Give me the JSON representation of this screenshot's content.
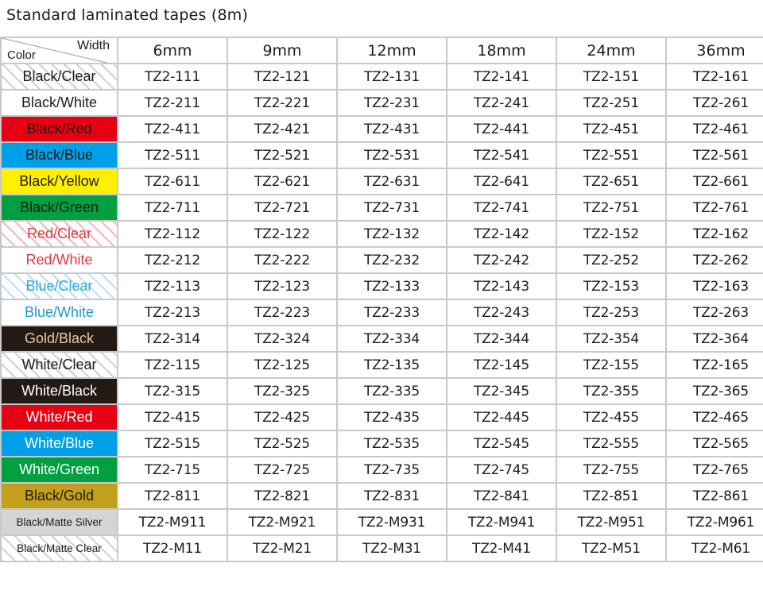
{
  "title": "Standard laminated tapes (8m)",
  "header": {
    "corner_row_label": "Color",
    "corner_col_label": "Width",
    "widths": [
      "6mm",
      "9mm",
      "12mm",
      "18mm",
      "24mm",
      "36mm"
    ]
  },
  "colors": {
    "header_bg": "#e2e2e2",
    "grid": "#c9c9c9",
    "red": "#e60012",
    "blue": "#00a0e9",
    "yellow": "#fff000",
    "green": "#00a040",
    "black": "#231a15",
    "gold_bg": "#c2a01b",
    "gold_text": "#e8c9a0",
    "silver": "#d4d4d4",
    "text_dark": "#1c1c1c",
    "white": "#ffffff"
  },
  "rows": [
    {
      "label": "Black/Clear",
      "bg": "#ffffff",
      "fg": "#1c1c1c",
      "hatch": "#c9c9c9",
      "small": false,
      "parts": [
        "TZ2-111",
        "TZ2-121",
        "TZ2-131",
        "TZ2-141",
        "TZ2-151",
        "TZ2-161"
      ]
    },
    {
      "label": "Black/White",
      "bg": "#ffffff",
      "fg": "#1c1c1c",
      "hatch": null,
      "small": false,
      "parts": [
        "TZ2-211",
        "TZ2-221",
        "TZ2-231",
        "TZ2-241",
        "TZ2-251",
        "TZ2-261"
      ]
    },
    {
      "label": "Black/Red",
      "bg": "#e60012",
      "fg": "#231a15",
      "hatch": null,
      "small": false,
      "parts": [
        "TZ2-411",
        "TZ2-421",
        "TZ2-431",
        "TZ2-441",
        "TZ2-451",
        "TZ2-461"
      ]
    },
    {
      "label": "Black/Blue",
      "bg": "#00a0e9",
      "fg": "#231a15",
      "hatch": null,
      "small": false,
      "parts": [
        "TZ2-511",
        "TZ2-521",
        "TZ2-531",
        "TZ2-541",
        "TZ2-551",
        "TZ2-561"
      ]
    },
    {
      "label": "Black/Yellow",
      "bg": "#fff000",
      "fg": "#231a15",
      "hatch": null,
      "small": false,
      "parts": [
        "TZ2-611",
        "TZ2-621",
        "TZ2-631",
        "TZ2-641",
        "TZ2-651",
        "TZ2-661"
      ]
    },
    {
      "label": "Black/Green",
      "bg": "#00a040",
      "fg": "#231a15",
      "hatch": null,
      "small": false,
      "parts": [
        "TZ2-711",
        "TZ2-721",
        "TZ2-731",
        "TZ2-741",
        "TZ2-751",
        "TZ2-761"
      ]
    },
    {
      "label": "Red/Clear",
      "bg": "#ffffff",
      "fg": "#e2373f",
      "hatch": "#f0a9ae",
      "small": false,
      "parts": [
        "TZ2-112",
        "TZ2-122",
        "TZ2-132",
        "TZ2-142",
        "TZ2-152",
        "TZ2-162"
      ]
    },
    {
      "label": "Red/White",
      "bg": "#ffffff",
      "fg": "#e2373f",
      "hatch": null,
      "small": false,
      "parts": [
        "TZ2-212",
        "TZ2-222",
        "TZ2-232",
        "TZ2-242",
        "TZ2-252",
        "TZ2-262"
      ]
    },
    {
      "label": "Blue/Clear",
      "bg": "#ffffff",
      "fg": "#2aa7e0",
      "hatch": "#abdcf3",
      "small": false,
      "parts": [
        "TZ2-113",
        "TZ2-123",
        "TZ2-133",
        "TZ2-143",
        "TZ2-153",
        "TZ2-163"
      ]
    },
    {
      "label": "Blue/White",
      "bg": "#ffffff",
      "fg": "#1b9ada",
      "hatch": null,
      "small": false,
      "parts": [
        "TZ2-213",
        "TZ2-223",
        "TZ2-233",
        "TZ2-243",
        "TZ2-253",
        "TZ2-263"
      ]
    },
    {
      "label": "Gold/Black",
      "bg": "#231a15",
      "fg": "#e8c9a0",
      "hatch": null,
      "small": false,
      "parts": [
        "TZ2-314",
        "TZ2-324",
        "TZ2-334",
        "TZ2-344",
        "TZ2-354",
        "TZ2-364"
      ]
    },
    {
      "label": "White/Clear",
      "bg": "#ffffff",
      "fg": "#1c1c1c",
      "hatch": "#c9c9c9",
      "small": false,
      "parts": [
        "TZ2-115",
        "TZ2-125",
        "TZ2-135",
        "TZ2-145",
        "TZ2-155",
        "TZ2-165"
      ]
    },
    {
      "label": "White/Black",
      "bg": "#231a15",
      "fg": "#ffffff",
      "hatch": null,
      "small": false,
      "parts": [
        "TZ2-315",
        "TZ2-325",
        "TZ2-335",
        "TZ2-345",
        "TZ2-355",
        "TZ2-365"
      ]
    },
    {
      "label": "White/Red",
      "bg": "#e60012",
      "fg": "#ffffff",
      "hatch": null,
      "small": false,
      "parts": [
        "TZ2-415",
        "TZ2-425",
        "TZ2-435",
        "TZ2-445",
        "TZ2-455",
        "TZ2-465"
      ]
    },
    {
      "label": "White/Blue",
      "bg": "#00a0e9",
      "fg": "#ffffff",
      "hatch": null,
      "small": false,
      "parts": [
        "TZ2-515",
        "TZ2-525",
        "TZ2-535",
        "TZ2-545",
        "TZ2-555",
        "TZ2-565"
      ]
    },
    {
      "label": "White/Green",
      "bg": "#00a040",
      "fg": "#ffffff",
      "hatch": null,
      "small": false,
      "parts": [
        "TZ2-715",
        "TZ2-725",
        "TZ2-735",
        "TZ2-745",
        "TZ2-755",
        "TZ2-765"
      ]
    },
    {
      "label": "Black/Gold",
      "bg": "#c2a01b",
      "fg": "#231a15",
      "hatch": null,
      "small": false,
      "parts": [
        "TZ2-811",
        "TZ2-821",
        "TZ2-831",
        "TZ2-841",
        "TZ2-851",
        "TZ2-861"
      ]
    },
    {
      "label": "Black/Matte Silver",
      "bg": "#d4d4d4",
      "fg": "#1c1c1c",
      "hatch": null,
      "small": true,
      "parts": [
        "TZ2-M911",
        "TZ2-M921",
        "TZ2-M931",
        "TZ2-M941",
        "TZ2-M951",
        "TZ2-M961"
      ]
    },
    {
      "label": "Black/Matte Clear",
      "bg": "#ffffff",
      "fg": "#1c1c1c",
      "hatch": "#c9c9c9",
      "small": true,
      "parts": [
        "TZ2-M11",
        "TZ2-M21",
        "TZ2-M31",
        "TZ2-M41",
        "TZ2-M51",
        "TZ2-M61"
      ]
    }
  ]
}
